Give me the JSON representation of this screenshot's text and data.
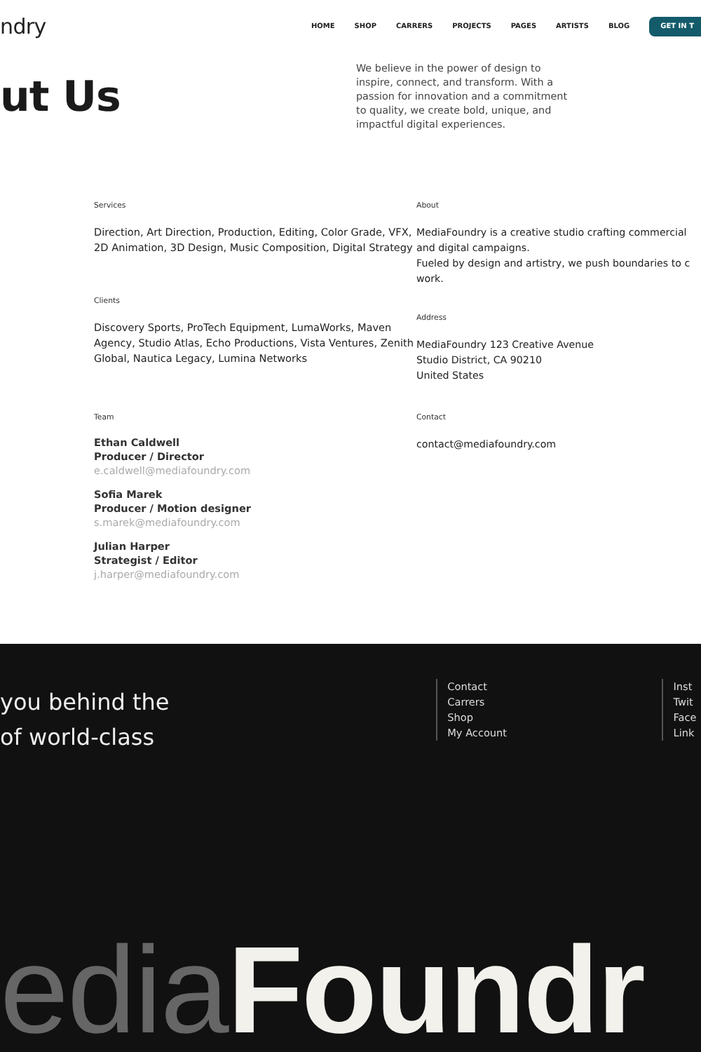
{
  "header": {
    "logo": "ndry",
    "nav": [
      "HOME",
      "SHOP",
      "CARRERS",
      "PROJECTS",
      "PAGES",
      "ARTISTS",
      "BLOG"
    ],
    "cta": "GET IN T"
  },
  "hero": {
    "title": "ut Us",
    "intro": "We believe in the power of design to inspire, connect, and transform. With a passion for innovation and a commitment to quality, we create bold, unique, and impactful digital experiences."
  },
  "left_sections": [
    {
      "label": "Services",
      "lines": [
        "Direction, Art Direction, Production, Editing, Color Grade, VFX, 2D Animation, 3D Design, Music Composition, Digital Strategy"
      ]
    },
    {
      "label": "Clients",
      "lines": [
        "Discovery Sports, ProTech Equipment, LumaWorks, Maven Agency, Studio Atlas, Echo Productions, Vista Ventures, Zenith Global, Nautica Legacy, Lumina Networks"
      ]
    }
  ],
  "team": {
    "label": "Team",
    "members": [
      {
        "name": "Ethan Caldwell",
        "role": "Producer / Director",
        "email": "e.caldwell@mediafoundry.com"
      },
      {
        "name": "Sofia Marek",
        "role": "Producer / Motion designer",
        "email": "s.marek@mediafoundry.com"
      },
      {
        "name": "Julian Harper",
        "role": "Strategist / Editor",
        "email": "j.harper@mediafoundry.com"
      }
    ]
  },
  "right_sections": [
    {
      "label": "About",
      "lines": [
        "MediaFoundry is a creative studio crafting commercial",
        "and digital campaigns.",
        "Fueled by design and artistry, we push boundaries to c",
        "work."
      ]
    },
    {
      "label": "Address",
      "lines": [
        "MediaFoundry 123 Creative Avenue",
        "Studio District, CA 90210",
        "United States"
      ]
    },
    {
      "label": "Contact",
      "lines": [
        "contact@mediafoundry.com"
      ]
    }
  ],
  "footer": {
    "tagline": [
      "you behind the",
      "of world-class"
    ],
    "links": [
      "Contact",
      "Carrers",
      "Shop",
      "My Account"
    ],
    "social": [
      "Inst",
      "Twit",
      "Face",
      "Link"
    ],
    "wordmark_light": "edia",
    "wordmark_bold": "Foundr"
  }
}
